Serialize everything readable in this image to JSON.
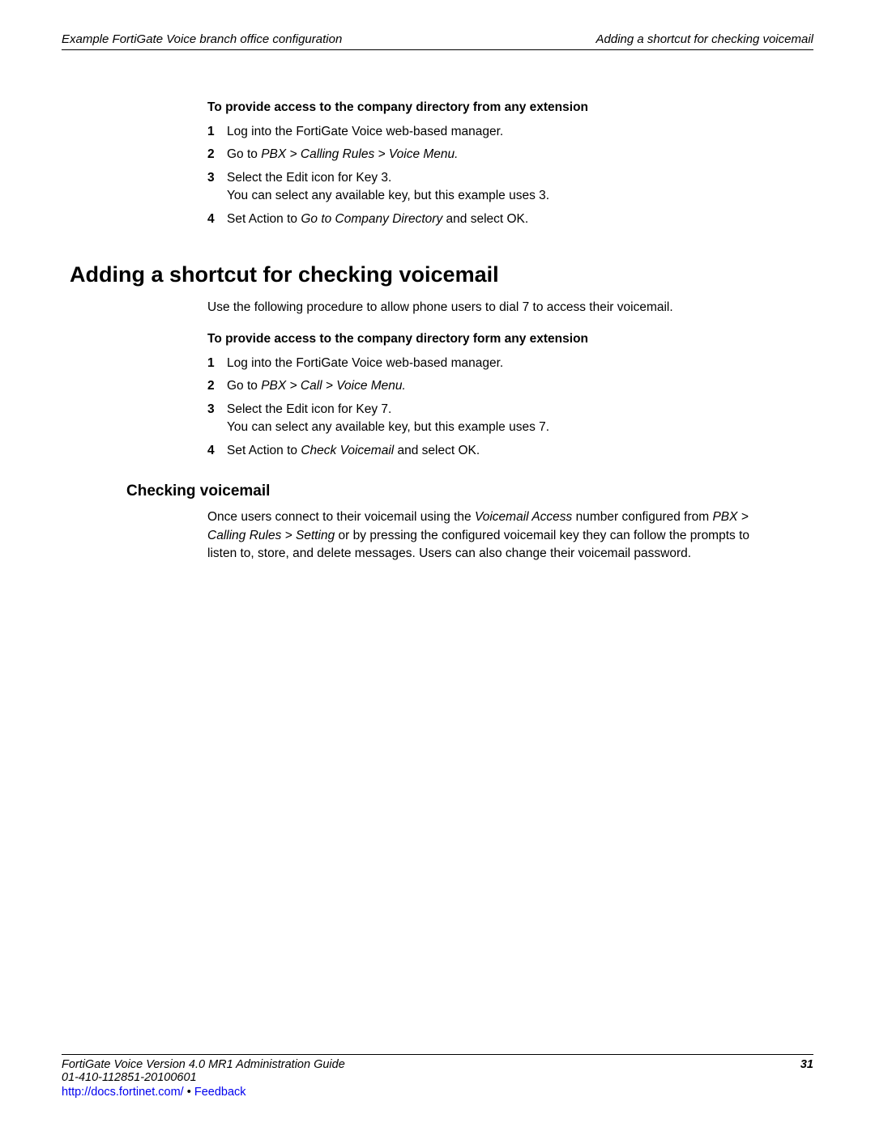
{
  "header": {
    "left": "Example FortiGate Voice branch office configuration",
    "right": "Adding a shortcut for checking voicemail"
  },
  "section1": {
    "heading": "To provide access to the company directory from any extension",
    "items": [
      {
        "n": "1",
        "text": "Log into the FortiGate Voice web-based manager."
      },
      {
        "n": "2",
        "pre": "Go to ",
        "em": "PBX > Calling Rules > Voice Menu."
      },
      {
        "n": "3",
        "text": "Select the Edit icon for Key 3.",
        "note": "You can select any available key, but this example uses 3."
      },
      {
        "n": "4",
        "pre": "Set Action to ",
        "em": "Go to Company Directory",
        "post": " and select OK."
      }
    ]
  },
  "mainHeading": "Adding a shortcut for checking voicemail",
  "intro": "Use the following procedure to allow phone users to dial 7 to access their voicemail.",
  "section2": {
    "heading": "To provide access to the company directory form any extension",
    "items": [
      {
        "n": "1",
        "text": "Log into the FortiGate Voice web-based manager."
      },
      {
        "n": "2",
        "pre": "Go to ",
        "em": "PBX > Call > Voice Menu."
      },
      {
        "n": "3",
        "text": "Select the Edit icon for Key 7.",
        "note": "You can select any available key, but this example uses 7."
      },
      {
        "n": "4",
        "pre": "Set Action to ",
        "em": "Check Voicemail",
        "post": " and select OK."
      }
    ]
  },
  "subHeading": "Checking voicemail",
  "cv": {
    "p1a": "Once users connect to their voicemail using the ",
    "p1em1": "Voicemail Access",
    "p1b": " number configured from ",
    "p1em2": "PBX > Calling Rules > Setting",
    "p1c": " or by pressing the configured voicemail key they can follow the prompts to listen to, store, and delete messages. Users can also change their voicemail password."
  },
  "footer": {
    "guide": "FortiGate Voice Version 4.0 MR1 Administration Guide",
    "docnum": "01-410-112851-20100601",
    "page": "31",
    "url": "http://docs.fortinet.com/",
    "sep": " • ",
    "feedback": "Feedback"
  }
}
